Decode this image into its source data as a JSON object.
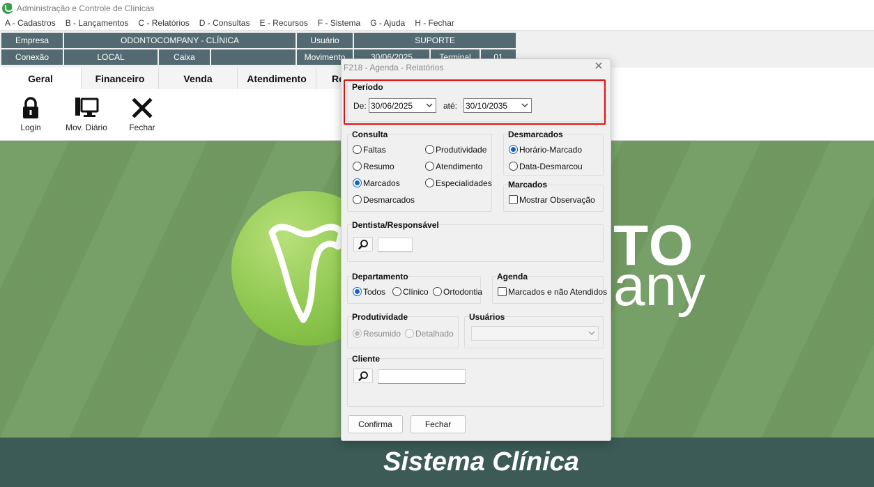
{
  "window": {
    "title": "Administração e Controle de Clínicas",
    "logo_icon": "app-tooth-logo"
  },
  "menu": [
    "A - Cadastros",
    "B - Lançamentos",
    "C - Relatórios",
    "D - Consultas",
    "E - Recursos",
    "F - Sistema",
    "G - Ajuda",
    "H - Fechar"
  ],
  "info": {
    "empresa_label": "Empresa",
    "empresa_value": "ODONTOCOMPANY - CLÍNICA",
    "usuario_label": "Usuário",
    "usuario_value": "SUPORTE",
    "conexao_label": "Conexão",
    "conexao_value": "LOCAL",
    "caixa_label": "Caixa",
    "caixa_value": "",
    "movimento_label": "Movimento",
    "movimento_value": "30/06/2025",
    "terminal_label": "Terminal",
    "terminal_value": "01"
  },
  "ribbon": {
    "tabs": [
      "Geral",
      "Financeiro",
      "Venda",
      "Atendimento",
      "Re"
    ],
    "active_tab": "Geral",
    "tools": [
      {
        "label": "Login",
        "icon": "lock-icon"
      },
      {
        "label": "Mov. Diário",
        "icon": "computer-icon"
      },
      {
        "label": "Fechar",
        "icon": "close-x-icon"
      }
    ]
  },
  "background": {
    "brand_line1": "TO",
    "brand_line2": "any",
    "footer": "Sistema Clínica",
    "colors": {
      "green": "#739d63",
      "footer": "#3c5b56",
      "cell": "#536a73"
    }
  },
  "dialog": {
    "title": "F218 - Agenda - Relatórios",
    "periodo": {
      "title": "Período",
      "de_label": "De:",
      "de_value": "30/06/2025",
      "ate_label": "até:",
      "ate_value": "30/10/2035"
    },
    "consulta": {
      "title": "Consulta",
      "options": [
        "Faltas",
        "Produtividade",
        "Resumo",
        "Atendimento",
        "Marcados",
        "Especialidades",
        "Desmarcados"
      ],
      "selected": "Marcados"
    },
    "desmarcados": {
      "title": "Desmarcados",
      "options": [
        "Horário-Marcado",
        "Data-Desmarcou"
      ],
      "selected": "Horário-Marcado"
    },
    "marcados": {
      "title": "Marcados",
      "checkbox": "Mostrar Observação",
      "checked": false
    },
    "dentista": {
      "title": "Dentista/Responsável",
      "value": ""
    },
    "departamento": {
      "title": "Departamento",
      "options": [
        "Todos",
        "Clínico",
        "Ortodontia"
      ],
      "selected": "Todos"
    },
    "agenda": {
      "title": "Agenda",
      "checkbox": "Marcados e não Atendidos",
      "checked": false
    },
    "produtividade": {
      "title": "Produtividade",
      "options": [
        "Resumido",
        "Detalhado"
      ],
      "selected": "Resumido",
      "disabled": true
    },
    "usuarios": {
      "title": "Usuários",
      "value": "",
      "disabled": true
    },
    "cliente": {
      "title": "Cliente",
      "value": ""
    },
    "buttons": {
      "confirm": "Confirma",
      "close": "Fechar"
    },
    "highlight_color": "#e01010"
  }
}
